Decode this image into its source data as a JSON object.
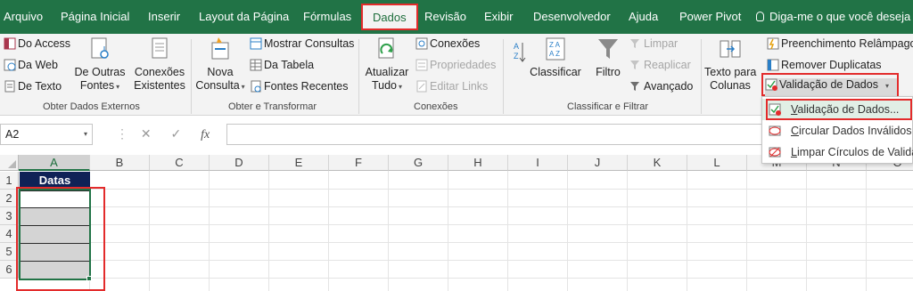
{
  "menu": {
    "tabs": [
      "Arquivo",
      "Página Inicial",
      "Inserir",
      "Layout da Página",
      "Fórmulas",
      "Dados",
      "Revisão",
      "Exibir",
      "Desenvolvedor",
      "Ajuda",
      "Power Pivot"
    ],
    "active_tab": "Dados",
    "tell_me": "Diga-me o que você deseja"
  },
  "ribbon": {
    "external": {
      "access": "Do Access",
      "web": "Da Web",
      "text": "De Texto",
      "other_sources_1": "De Outras",
      "other_sources_2": "Fontes",
      "connections_1": "Conexões",
      "connections_2": "Existentes",
      "label": "Obter Dados Externos"
    },
    "transform": {
      "new_query_1": "Nova",
      "new_query_2": "Consulta",
      "show_queries": "Mostrar Consultas",
      "from_table": "Da Tabela",
      "recent_sources": "Fontes Recentes",
      "label": "Obter e Transformar"
    },
    "connections": {
      "refresh_1": "Atualizar",
      "refresh_2": "Tudo",
      "connections": "Conexões",
      "properties": "Propriedades",
      "edit_links": "Editar Links",
      "label": "Conexões"
    },
    "sort_filter": {
      "sort": "Classificar",
      "filter": "Filtro",
      "clear": "Limpar",
      "reapply": "Reaplicar",
      "advanced": "Avançado",
      "label": "Classificar e Filtrar"
    },
    "data_tools": {
      "text_to_cols_1": "Texto para",
      "text_to_cols_2": "Colunas",
      "flash_fill": "Preenchimento Relâmpago",
      "remove_dup": "Remover Duplicatas",
      "validation": "Validação de Dados"
    }
  },
  "dropdown": {
    "items": [
      {
        "pre": "",
        "u": "V",
        "rest": "alidação de Dados..."
      },
      {
        "pre": "",
        "u": "C",
        "rest": "ircular Dados Inválidos"
      },
      {
        "pre": "",
        "u": "L",
        "rest": "impar Círculos de Validação"
      }
    ]
  },
  "formula_bar": {
    "name_box": "A2",
    "fx": "fx",
    "value": ""
  },
  "sheet": {
    "columns": [
      "A",
      "B",
      "C",
      "D",
      "E",
      "F",
      "G",
      "H",
      "I",
      "J",
      "K",
      "L",
      "M",
      "N",
      "O"
    ],
    "rows": [
      "1",
      "2",
      "3",
      "4",
      "5",
      "6"
    ],
    "a1": "Datas"
  },
  "colors": {
    "excel_green": "#217346",
    "highlight_red": "#e32b2b",
    "header_navy": "#0f2256"
  }
}
